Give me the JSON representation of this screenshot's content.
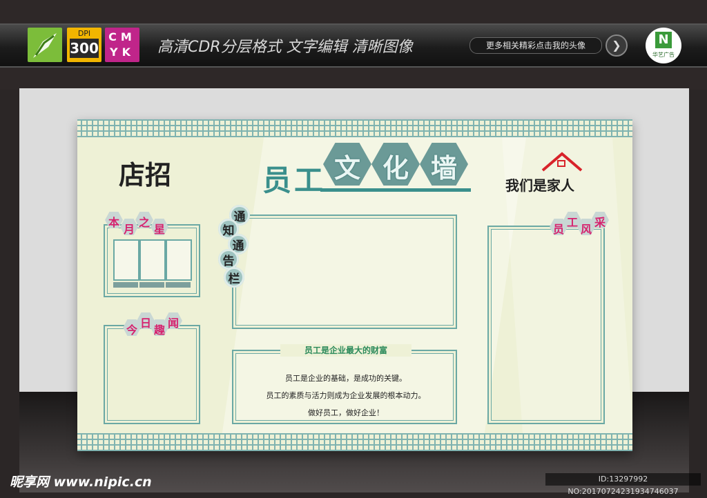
{
  "header": {
    "dpi_label": "DPI",
    "dpi_value": "300",
    "cmyk_line1": "CM",
    "cmyk_line2": "YK",
    "tagline": "高清CDR分层格式   文字编辑   清晰图像",
    "more_link": "更多相关精彩点击我的头像",
    "brand_letter": "N",
    "brand_name": "华艺广告"
  },
  "board": {
    "shop_sign": "店招",
    "title_prefix": "员工",
    "title_hex": [
      "文",
      "化",
      "墙"
    ],
    "home_text": "我们是家人",
    "star_of_month": [
      "本",
      "月",
      "之",
      "星"
    ],
    "notice": [
      "通",
      "知",
      "通",
      "告",
      "栏"
    ],
    "staff_style": [
      "员",
      "工",
      "风",
      "采"
    ],
    "fun_today": [
      "今",
      "日",
      "趣",
      "闻"
    ],
    "wealth_heading": "员工是企业最大的财富",
    "paragraphs": [
      "员工是企业的基础，是成功的关键。",
      "员工的素质与活力则成为企业发展的根本动力。",
      "做好员工，做好企业！"
    ]
  },
  "watermark": {
    "site": "昵享网 www.nipic.cn",
    "id_line": "ID:13297992 NO:20170724231934746037"
  },
  "colors": {
    "board_bg": "#eef1d6",
    "teal": "#6aa8a4",
    "title_teal": "#3a8f8c",
    "pink": "#d6226e",
    "roof_red": "#d8232a"
  }
}
